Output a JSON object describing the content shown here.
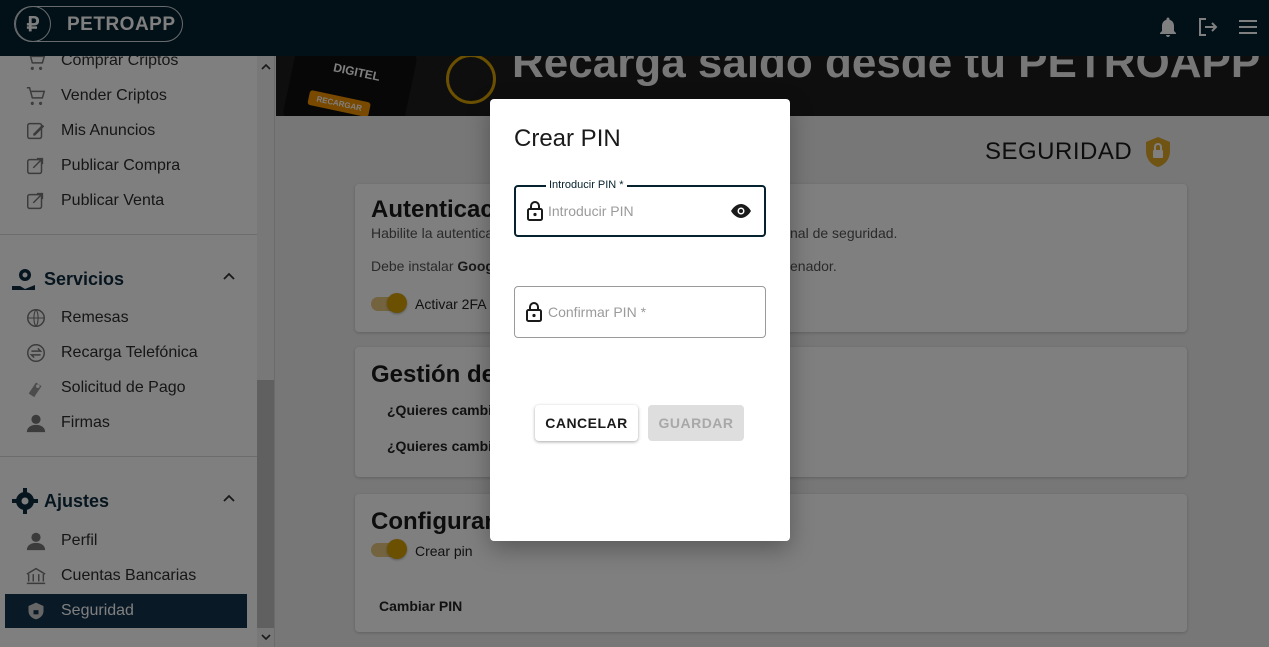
{
  "app": {
    "name": "PETROAPP",
    "logo_glyph": "₽"
  },
  "topbar": {
    "icons": [
      "bell-icon",
      "logout-icon",
      "menu-icon"
    ]
  },
  "sidebar": {
    "items_top": [
      {
        "label": "Comprar Criptos",
        "icon": "cart-icon"
      },
      {
        "label": "Vender Criptos",
        "icon": "cart-sell-icon"
      },
      {
        "label": "Mis Anuncios",
        "icon": "edit-icon"
      },
      {
        "label": "Publicar Compra",
        "icon": "publish-icon"
      },
      {
        "label": "Publicar Venta",
        "icon": "publish-icon"
      }
    ],
    "servicios": {
      "title": "Servicios",
      "items": [
        {
          "label": "Remesas",
          "icon": "globe-money-icon"
        },
        {
          "label": "Recarga Telefónica",
          "icon": "exchange-icon"
        },
        {
          "label": "Solicitud de Pago",
          "icon": "payment-icon"
        },
        {
          "label": "Firmas",
          "icon": "person-icon"
        }
      ]
    },
    "ajustes": {
      "title": "Ajustes",
      "items": [
        {
          "label": "Perfil",
          "icon": "person-icon"
        },
        {
          "label": "Cuentas Bancarias",
          "icon": "bank-icon"
        },
        {
          "label": "Seguridad",
          "icon": "shield-icon"
        }
      ]
    }
  },
  "banner": {
    "text": "Recarga saldo desde tu PETROAPP",
    "phone_brand": "DIGITEL",
    "phone_button": "RECARGAR"
  },
  "page": {
    "title": "SEGURIDAD"
  },
  "cards": {
    "auth": {
      "title": "Autenticaci",
      "line1_start": "Habilite la autentica",
      "line1_end": "nal de seguridad.",
      "line2_start": "Debe instalar ",
      "line2_bold": "Goog",
      "line2_end": "enador.",
      "toggle_label": "Activar 2FA",
      "toggle_on": true
    },
    "gestion": {
      "title": "Gestión de",
      "q1": "¿Quieres cambia",
      "q2": "¿Quieres cambia"
    },
    "config": {
      "title": "Configurar",
      "toggle_label": "Crear pin",
      "toggle_on": true,
      "link": "Cambiar PIN"
    }
  },
  "modal": {
    "title": "Crear PIN",
    "pin_field": {
      "label": "Introducir PIN *",
      "placeholder": "Introducir PIN",
      "value": ""
    },
    "confirm_field": {
      "placeholder": "Confirmar PIN *",
      "value": ""
    },
    "cancel_label": "CANCELAR",
    "save_label": "GUARDAR",
    "save_disabled": true
  },
  "colors": {
    "topbar": "#05222e",
    "accent": "#d4a000",
    "active_nav": "#12334a"
  }
}
